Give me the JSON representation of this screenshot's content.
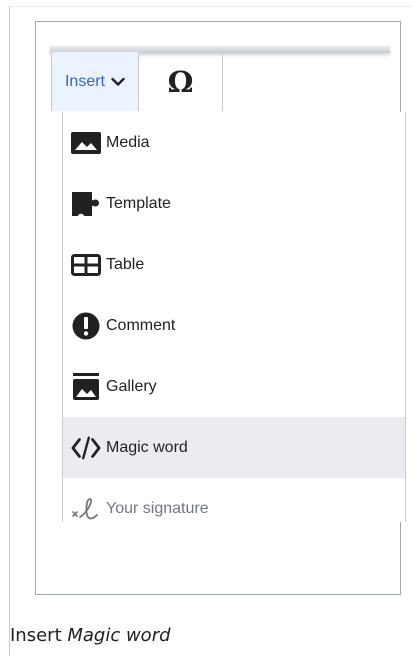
{
  "toolbar": {
    "insert_label": "Insert",
    "special_char_label": "Ω"
  },
  "menu": {
    "items": [
      {
        "label": "Media",
        "icon": "image-icon"
      },
      {
        "label": "Template",
        "icon": "puzzle-icon"
      },
      {
        "label": "Table",
        "icon": "table-icon"
      },
      {
        "label": "Comment",
        "icon": "alert-icon"
      },
      {
        "label": "Gallery",
        "icon": "gallery-icon"
      },
      {
        "label": "Magic word",
        "icon": "code-icon",
        "highlighted": true
      },
      {
        "label": "Your signature",
        "icon": "signature-icon",
        "disabled": true
      }
    ]
  },
  "caption": {
    "prefix": "Insert ",
    "emphasis": "Magic word"
  },
  "colors": {
    "accent": "#3366cc",
    "tab_active_bg": "#eaf3ff",
    "highlight_bg": "#eaecf0",
    "border": "#c8ccd1",
    "text": "#202122",
    "disabled_text": "#72777d"
  }
}
